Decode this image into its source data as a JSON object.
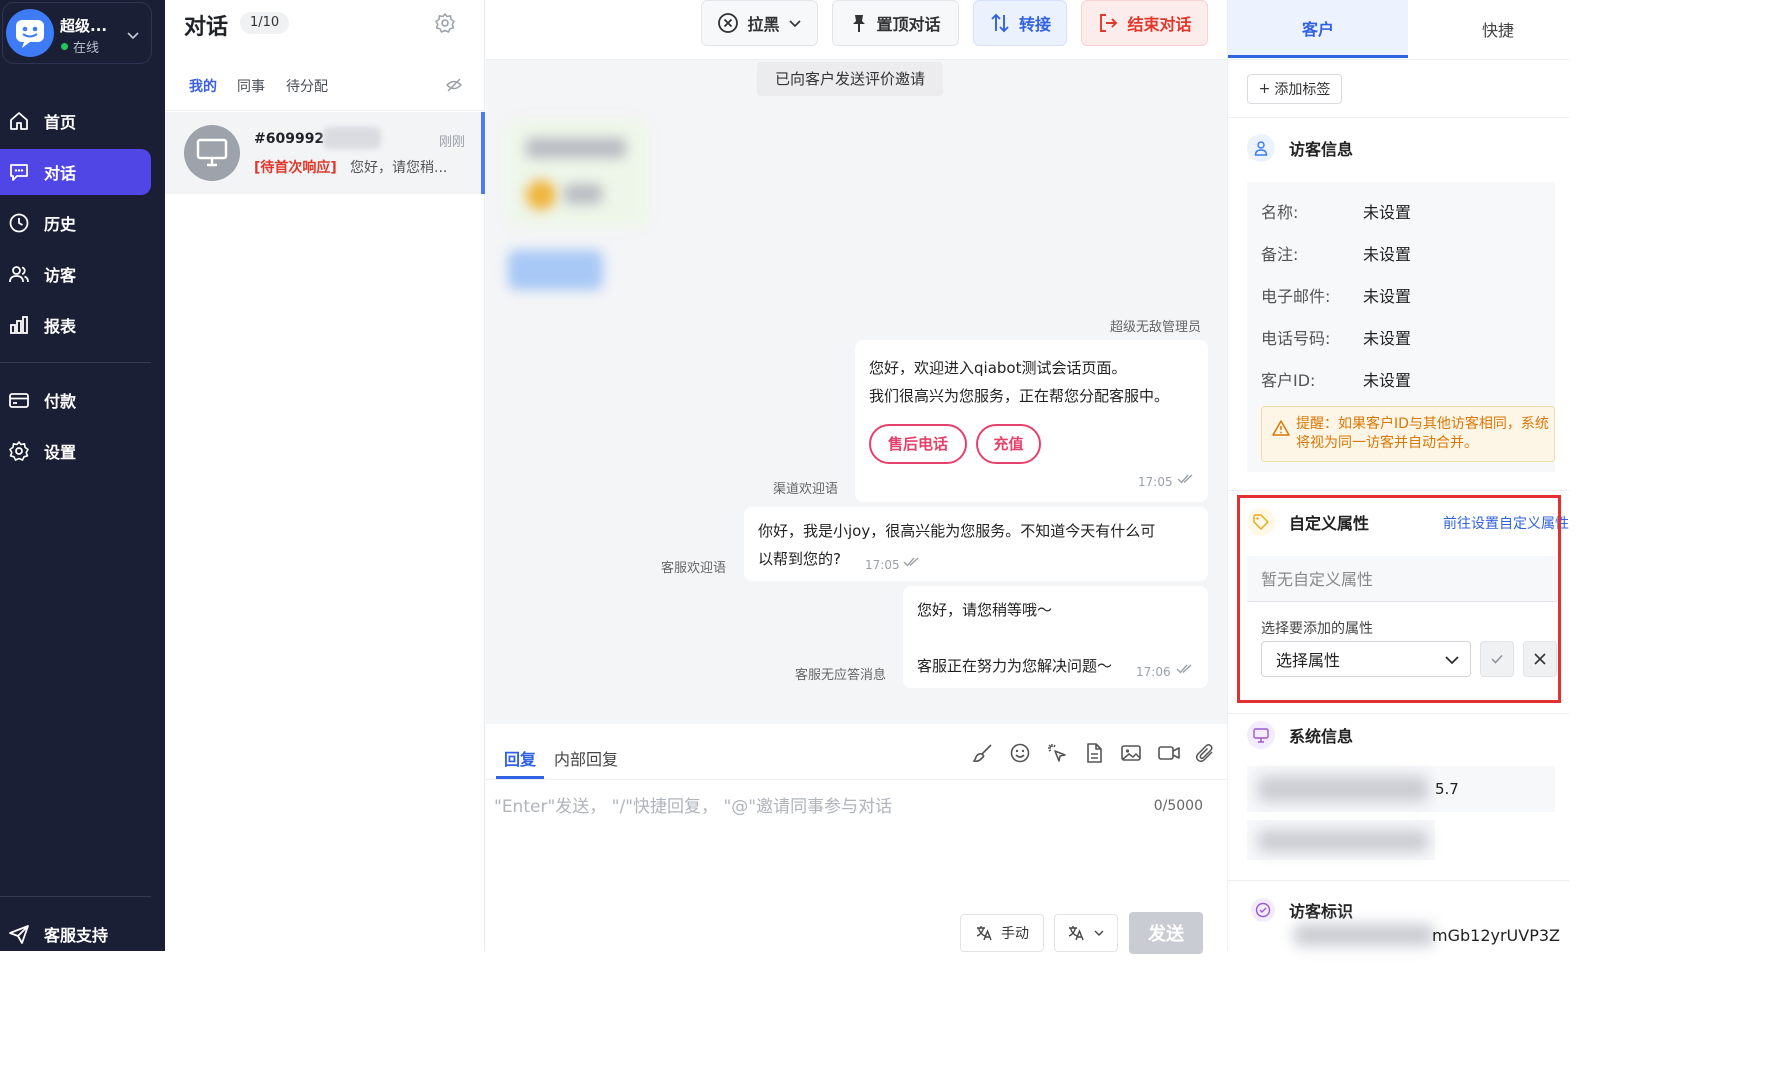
{
  "nav": {
    "account": {
      "name": "超级...",
      "status": "在线"
    },
    "items": [
      {
        "label": "首页",
        "icon": "home-icon"
      },
      {
        "label": "对话",
        "icon": "chat-icon",
        "active": true
      },
      {
        "label": "历史",
        "icon": "history-icon"
      },
      {
        "label": "访客",
        "icon": "visitors-icon"
      },
      {
        "label": "报表",
        "icon": "report-icon"
      },
      {
        "label": "付款",
        "icon": "payment-icon"
      },
      {
        "label": "设置",
        "icon": "settings-icon"
      }
    ],
    "support": "客服支持"
  },
  "list": {
    "title": "对话",
    "count": "1/10",
    "tabs": [
      "我的",
      "同事",
      "待分配"
    ],
    "conversation": {
      "id": "#609992",
      "time": "刚刚",
      "tag": "[待首次响应]",
      "preview": "您好，请您稍..."
    }
  },
  "chat": {
    "toolbar": {
      "block": "拉黑",
      "pin": "置顶对话",
      "transfer": "转接",
      "end": "结束对话"
    },
    "notice": "已向客户发送评价邀请",
    "sender_admin": "超级无敌管理员",
    "messages": {
      "welcome": {
        "line1": "您好，欢迎进入qiabot测试会话页面。",
        "line2": "我们很高兴为您服务，正在帮您分配客服中。",
        "chip1": "售后电话",
        "chip2": "充值",
        "time": "17:05",
        "label": "渠道欢迎语"
      },
      "agent_welcome": {
        "line1": "你好，我是小joy，很高兴能为您服务。不知道今天有什么可",
        "line2": "以帮到您的?",
        "time": "17:05",
        "label": "客服欢迎语"
      },
      "no_answer": {
        "line1": "您好，请您稍等哦～",
        "line2": "客服正在努力为您解决问题～",
        "time": "17:06",
        "label": "客服无应答消息"
      }
    },
    "compose": {
      "tab_reply": "回复",
      "tab_internal": "内部回复",
      "placeholder": "\"Enter\"发送， \"/\"快捷回复， \"@\"邀请同事参与对话",
      "counter": "0/5000",
      "manual": "手动",
      "send": "发送"
    }
  },
  "right": {
    "tabs": {
      "customer": "客户",
      "quick": "快捷"
    },
    "add_tag": "添加标签",
    "visitor_info": {
      "title": "访客信息",
      "fields": [
        {
          "key": "名称:",
          "value": "未设置"
        },
        {
          "key": "备注:",
          "value": "未设置"
        },
        {
          "key": "电子邮件:",
          "value": "未设置"
        },
        {
          "key": "电话号码:",
          "value": "未设置"
        },
        {
          "key": "客户ID:",
          "value": "未设置"
        }
      ],
      "warning_line1": "提醒：如果客户ID与其他访客相同，系统",
      "warning_line2": "将视为同一访客并自动合并。"
    },
    "custom_attrs": {
      "title": "自定义属性",
      "link": "前往设置自定义属性",
      "empty": "暂无自定义属性",
      "select_label": "选择要添加的属性",
      "select_value": "选择属性"
    },
    "system_info": {
      "title": "系统信息",
      "value_tail": "5.7"
    },
    "visitor_id": {
      "title": "访客标识",
      "value_tail": "mGb12yrUVP3Z"
    }
  }
}
